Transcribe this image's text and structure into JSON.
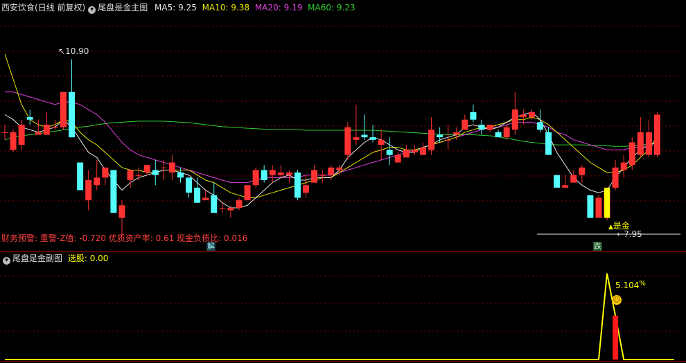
{
  "header": {
    "stock_name": "西安饮食",
    "period": "(日线 前复权)",
    "indicator": "尾盘是金主图",
    "ma": [
      {
        "label": "MA5:",
        "value": "9.25",
        "color": "#e8e8e8"
      },
      {
        "label": "MA10:",
        "value": "9.38",
        "color": "#e8e800"
      },
      {
        "label": "MA20:",
        "value": "9.19",
        "color": "#e040e0"
      },
      {
        "label": "MA60:",
        "value": "9.23",
        "color": "#30d030"
      }
    ]
  },
  "finance_line": "财务预警: 重警-Z值: -0.720 优质资产率: 0.61 现金负债比: 0.016",
  "annotations": {
    "high_label": "10.90",
    "low_label": "7.95",
    "signal_label": "是金",
    "event_jie": "解",
    "event_die": "跌"
  },
  "sub": {
    "title": "尾盘是金副图",
    "select_label": "选股:",
    "select_value": "0.00",
    "peak_label": "5.104"
  },
  "colors": {
    "up": "#ff3232",
    "down": "#54fcfc",
    "ma5": "#e8e8e8",
    "ma10": "#e8e800",
    "ma20": "#e040e0",
    "ma60": "#30d030",
    "signal": "#ffff00",
    "grid": "#8b0000"
  },
  "chart_data": {
    "type": "candlestick",
    "price_range": [
      7.4,
      11.8
    ],
    "candles": [
      {
        "o": 9.45,
        "h": 9.6,
        "l": 9.3,
        "c": 9.45
      },
      {
        "o": 9.1,
        "h": 9.5,
        "l": 9.05,
        "c": 9.45
      },
      {
        "o": 9.2,
        "h": 9.7,
        "l": 9.1,
        "c": 9.6
      },
      {
        "o": 9.75,
        "h": 9.9,
        "l": 9.6,
        "c": 9.7
      },
      {
        "o": 9.4,
        "h": 9.7,
        "l": 9.4,
        "c": 9.45
      },
      {
        "o": 9.4,
        "h": 9.85,
        "l": 9.4,
        "c": 9.6
      },
      {
        "o": 9.55,
        "h": 9.7,
        "l": 9.5,
        "c": 9.55
      },
      {
        "o": 9.55,
        "h": 10.25,
        "l": 9.5,
        "c": 10.25
      },
      {
        "o": 10.25,
        "h": 10.9,
        "l": 9.35,
        "c": 9.35
      },
      {
        "o": 8.85,
        "h": 8.85,
        "l": 8.3,
        "c": 8.3
      },
      {
        "o": 8.1,
        "h": 8.7,
        "l": 7.9,
        "c": 8.5
      },
      {
        "o": 8.4,
        "h": 8.9,
        "l": 8.3,
        "c": 8.55
      },
      {
        "o": 8.55,
        "h": 8.7,
        "l": 8.4,
        "c": 8.75
      },
      {
        "o": 8.7,
        "h": 8.7,
        "l": 7.85,
        "c": 7.85
      },
      {
        "o": 7.75,
        "h": 8.1,
        "l": 7.4,
        "c": 8.0
      },
      {
        "o": 8.5,
        "h": 8.7,
        "l": 8.35,
        "c": 8.7
      },
      {
        "o": 8.6,
        "h": 8.75,
        "l": 8.5,
        "c": 8.6
      },
      {
        "o": 8.65,
        "h": 8.8,
        "l": 8.6,
        "c": 8.8
      },
      {
        "o": 8.7,
        "h": 8.9,
        "l": 8.4,
        "c": 8.6
      },
      {
        "o": 8.75,
        "h": 8.9,
        "l": 8.5,
        "c": 8.75
      },
      {
        "o": 8.65,
        "h": 9.0,
        "l": 8.5,
        "c": 8.85
      },
      {
        "o": 8.65,
        "h": 8.75,
        "l": 8.45,
        "c": 8.55
      },
      {
        "o": 8.55,
        "h": 8.55,
        "l": 8.15,
        "c": 8.25
      },
      {
        "o": 8.35,
        "h": 8.55,
        "l": 8.05,
        "c": 8.05
      },
      {
        "o": 8.1,
        "h": 8.3,
        "l": 8.1,
        "c": 8.15
      },
      {
        "o": 8.2,
        "h": 8.45,
        "l": 7.85,
        "c": 7.85
      },
      {
        "o": 7.95,
        "h": 8.05,
        "l": 7.85,
        "c": 7.95
      },
      {
        "o": 7.9,
        "h": 8.0,
        "l": 7.75,
        "c": 7.95
      },
      {
        "o": 7.95,
        "h": 8.15,
        "l": 7.9,
        "c": 8.1
      },
      {
        "o": 8.1,
        "h": 8.4,
        "l": 8.1,
        "c": 8.4
      },
      {
        "o": 8.4,
        "h": 8.75,
        "l": 8.35,
        "c": 8.7
      },
      {
        "o": 8.7,
        "h": 8.8,
        "l": 8.45,
        "c": 8.5
      },
      {
        "o": 8.6,
        "h": 8.8,
        "l": 8.45,
        "c": 8.7
      },
      {
        "o": 8.6,
        "h": 8.8,
        "l": 8.55,
        "c": 8.65
      },
      {
        "o": 8.6,
        "h": 8.7,
        "l": 8.45,
        "c": 8.65
      },
      {
        "o": 8.65,
        "h": 8.7,
        "l": 8.1,
        "c": 8.15
      },
      {
        "o": 8.25,
        "h": 8.6,
        "l": 8.15,
        "c": 8.4
      },
      {
        "o": 8.45,
        "h": 8.8,
        "l": 8.45,
        "c": 8.7
      },
      {
        "o": 8.6,
        "h": 8.7,
        "l": 8.45,
        "c": 8.6
      },
      {
        "o": 8.6,
        "h": 8.8,
        "l": 8.5,
        "c": 8.75
      },
      {
        "o": 8.7,
        "h": 8.8,
        "l": 8.6,
        "c": 8.75
      },
      {
        "o": 9.0,
        "h": 9.65,
        "l": 8.9,
        "c": 9.55
      },
      {
        "o": 9.3,
        "h": 10.0,
        "l": 9.2,
        "c": 9.35
      },
      {
        "o": 9.4,
        "h": 9.8,
        "l": 9.3,
        "c": 9.35
      },
      {
        "o": 9.35,
        "h": 9.6,
        "l": 9.25,
        "c": 9.3
      },
      {
        "o": 9.2,
        "h": 9.5,
        "l": 8.9,
        "c": 9.3
      },
      {
        "o": 9.1,
        "h": 9.35,
        "l": 8.8,
        "c": 9.0
      },
      {
        "o": 8.85,
        "h": 9.05,
        "l": 8.85,
        "c": 9.0
      },
      {
        "o": 8.95,
        "h": 9.2,
        "l": 8.95,
        "c": 9.1
      },
      {
        "o": 9.05,
        "h": 9.2,
        "l": 9.0,
        "c": 9.1
      },
      {
        "o": 9.0,
        "h": 9.25,
        "l": 9.0,
        "c": 9.15
      },
      {
        "o": 9.1,
        "h": 9.75,
        "l": 9.0,
        "c": 9.5
      },
      {
        "o": 9.4,
        "h": 9.55,
        "l": 9.25,
        "c": 9.35
      },
      {
        "o": 9.3,
        "h": 9.6,
        "l": 9.1,
        "c": 9.3
      },
      {
        "o": 9.4,
        "h": 9.55,
        "l": 9.3,
        "c": 9.45
      },
      {
        "o": 9.5,
        "h": 9.8,
        "l": 9.5,
        "c": 9.7
      },
      {
        "o": 9.85,
        "h": 10.0,
        "l": 9.65,
        "c": 9.7
      },
      {
        "o": 9.6,
        "h": 9.7,
        "l": 9.4,
        "c": 9.5
      },
      {
        "o": 9.5,
        "h": 9.6,
        "l": 9.45,
        "c": 9.6
      },
      {
        "o": 9.45,
        "h": 9.5,
        "l": 9.35,
        "c": 9.35
      },
      {
        "o": 9.35,
        "h": 9.6,
        "l": 9.3,
        "c": 9.55
      },
      {
        "o": 9.5,
        "h": 10.25,
        "l": 9.4,
        "c": 9.9
      },
      {
        "o": 9.75,
        "h": 9.9,
        "l": 9.6,
        "c": 9.8
      },
      {
        "o": 9.75,
        "h": 9.9,
        "l": 9.7,
        "c": 9.85
      },
      {
        "o": 9.65,
        "h": 9.9,
        "l": 9.45,
        "c": 9.5
      },
      {
        "o": 9.45,
        "h": 9.55,
        "l": 9.0,
        "c": 9.0
      },
      {
        "o": 8.6,
        "h": 8.6,
        "l": 8.35,
        "c": 8.35
      },
      {
        "o": 8.35,
        "h": 8.6,
        "l": 8.35,
        "c": 8.4
      },
      {
        "o": 8.45,
        "h": 8.7,
        "l": 8.45,
        "c": 8.6
      },
      {
        "o": 8.6,
        "h": 8.8,
        "l": 8.45,
        "c": 8.75
      },
      {
        "o": 8.2,
        "h": 8.2,
        "l": 7.75,
        "c": 7.75
      },
      {
        "o": 7.75,
        "h": 8.2,
        "l": 7.75,
        "c": 8.15
      },
      {
        "o": 7.75,
        "h": 8.35,
        "l": 7.7,
        "c": 8.3
      },
      {
        "o": 8.35,
        "h": 8.9,
        "l": 8.3,
        "c": 8.75
      },
      {
        "o": 8.7,
        "h": 9.0,
        "l": 8.55,
        "c": 8.85
      },
      {
        "o": 8.8,
        "h": 9.35,
        "l": 8.7,
        "c": 9.25
      },
      {
        "o": 9.0,
        "h": 9.75,
        "l": 8.95,
        "c": 9.45
      },
      {
        "o": 9.0,
        "h": 9.7,
        "l": 8.95,
        "c": 9.45
      },
      {
        "o": 9.0,
        "h": 9.85,
        "l": 8.95,
        "c": 9.8
      }
    ],
    "ma5": [
      9.8,
      9.7,
      9.55,
      9.5,
      9.45,
      9.5,
      9.55,
      9.7,
      9.55,
      9.3,
      9.05,
      8.95,
      8.7,
      8.5,
      8.3,
      8.45,
      8.55,
      8.6,
      8.65,
      8.7,
      8.7,
      8.65,
      8.6,
      8.45,
      8.3,
      8.2,
      8.05,
      7.95,
      7.95,
      8.0,
      8.15,
      8.3,
      8.45,
      8.55,
      8.6,
      8.5,
      8.5,
      8.55,
      8.55,
      8.55,
      8.7,
      8.95,
      9.1,
      9.25,
      9.35,
      9.3,
      9.2,
      9.1,
      9.05,
      9.05,
      9.15,
      9.2,
      9.3,
      9.35,
      9.4,
      9.55,
      9.6,
      9.55,
      9.5,
      9.55,
      9.65,
      9.75,
      9.8,
      9.85,
      9.7,
      9.4,
      9.05,
      8.8,
      8.55,
      8.4,
      8.3,
      8.25,
      8.3,
      8.55,
      8.75,
      8.95,
      9.1,
      9.2,
      9.25
    ],
    "ma10": [
      11.0,
      10.5,
      10.0,
      9.7,
      9.6,
      9.55,
      9.6,
      9.7,
      9.65,
      9.45,
      9.3,
      9.2,
      9.05,
      8.9,
      8.75,
      8.7,
      8.7,
      8.65,
      8.65,
      8.7,
      8.7,
      8.7,
      8.7,
      8.6,
      8.5,
      8.45,
      8.35,
      8.25,
      8.2,
      8.15,
      8.15,
      8.2,
      8.25,
      8.3,
      8.35,
      8.4,
      8.45,
      8.5,
      8.55,
      8.55,
      8.65,
      8.75,
      8.85,
      8.95,
      9.05,
      9.1,
      9.15,
      9.15,
      9.1,
      9.1,
      9.15,
      9.2,
      9.25,
      9.3,
      9.35,
      9.45,
      9.5,
      9.55,
      9.55,
      9.6,
      9.65,
      9.7,
      9.7,
      9.75,
      9.7,
      9.6,
      9.45,
      9.3,
      9.15,
      9.0,
      8.85,
      8.75,
      8.65,
      8.65,
      8.7,
      8.8,
      8.95,
      9.1,
      9.38
    ],
    "ma20": [
      10.25,
      10.25,
      10.2,
      10.15,
      10.1,
      10.05,
      10.0,
      10.05,
      10.05,
      10.0,
      9.9,
      9.8,
      9.65,
      9.45,
      9.25,
      9.1,
      9.0,
      8.95,
      8.9,
      8.85,
      8.8,
      8.75,
      8.7,
      8.65,
      8.6,
      8.55,
      8.5,
      8.45,
      8.45,
      8.45,
      8.5,
      8.55,
      8.55,
      8.55,
      8.55,
      8.55,
      8.6,
      8.6,
      8.6,
      8.6,
      8.65,
      8.7,
      8.75,
      8.8,
      8.85,
      8.9,
      8.95,
      9.0,
      9.05,
      9.1,
      9.15,
      9.2,
      9.25,
      9.3,
      9.35,
      9.4,
      9.45,
      9.5,
      9.55,
      9.55,
      9.6,
      9.65,
      9.65,
      9.65,
      9.6,
      9.55,
      9.45,
      9.4,
      9.3,
      9.25,
      9.2,
      9.15,
      9.1,
      9.1,
      9.1,
      9.15,
      9.15,
      9.2,
      9.19
    ],
    "ma60": [
      9.3,
      9.35,
      9.38,
      9.4,
      9.42,
      9.45,
      9.47,
      9.5,
      9.52,
      9.55,
      9.57,
      9.6,
      9.62,
      9.64,
      9.65,
      9.66,
      9.67,
      9.67,
      9.67,
      9.67,
      9.66,
      9.65,
      9.64,
      9.62,
      9.6,
      9.58,
      9.56,
      9.55,
      9.54,
      9.53,
      9.52,
      9.51,
      9.5,
      9.5,
      9.5,
      9.5,
      9.49,
      9.49,
      9.49,
      9.49,
      9.49,
      9.49,
      9.49,
      9.49,
      9.49,
      9.48,
      9.47,
      9.46,
      9.45,
      9.44,
      9.43,
      9.42,
      9.41,
      9.4,
      9.4,
      9.4,
      9.4,
      9.39,
      9.38,
      9.36,
      9.33,
      9.3,
      9.27,
      9.25,
      9.23,
      9.21,
      9.2,
      9.2,
      9.2,
      9.2,
      9.19,
      9.18,
      9.18,
      9.17,
      9.17,
      9.18,
      9.2,
      9.22,
      9.23
    ],
    "sub_line": [
      0,
      0,
      0,
      0,
      0,
      0,
      0,
      0,
      0,
      0,
      0,
      0,
      0,
      0,
      0,
      0,
      0,
      0,
      0,
      0,
      0,
      0,
      0,
      0,
      0,
      0,
      0,
      0,
      0,
      0,
      0,
      0,
      0,
      0,
      0,
      0,
      0,
      0,
      0,
      0,
      0,
      0,
      0,
      0,
      0,
      0,
      0,
      0,
      0,
      0,
      0,
      0,
      0,
      0,
      0,
      0,
      0,
      0,
      0,
      0,
      0,
      0,
      0,
      0,
      0,
      0,
      0,
      0,
      0,
      0,
      0,
      0,
      5.104,
      2.6,
      0,
      0,
      0,
      0,
      0,
      0,
      0
    ],
    "sub_range": [
      0,
      5.5
    ],
    "signal_bar_value": 2.6
  }
}
